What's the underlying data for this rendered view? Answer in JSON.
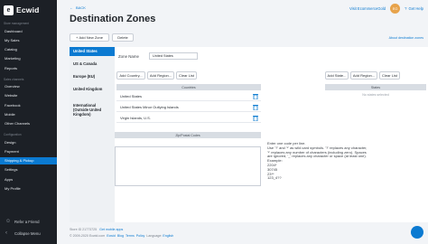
{
  "sidebar": {
    "brand": "Ecwid",
    "sections": [
      {
        "title": "Store management",
        "items": [
          "Dashboard",
          "My Sales",
          "Catalog",
          "Marketing",
          "Reports"
        ]
      },
      {
        "title": "Sales channels",
        "items": [
          "Overview",
          "Website",
          "Facebook",
          "Mobile",
          "Other Channels"
        ]
      },
      {
        "title": "Configuration",
        "items": [
          "Design",
          "Payment",
          "Shipping & Pickup",
          "Settings",
          "Apps",
          "My Profile"
        ]
      }
    ],
    "active": "Shipping & Pickup",
    "refer": "Refer a Friend",
    "collapse": "Collapse Menu"
  },
  "header": {
    "back": "BACK",
    "title": "Destination Zones",
    "webapp": "Visit EcommerceGold",
    "avatar": "EG",
    "help": "Get Help"
  },
  "toolbar": {
    "add": "Add New Zone",
    "delete": "Delete",
    "about": "About destination zones"
  },
  "zones": [
    "United States",
    "US & Canada",
    "Europe (EU)",
    "United Kingdom",
    "International (Outside United Kingdom)"
  ],
  "zone_form": {
    "name_label": "Zone Name",
    "name_value": "United States",
    "add_country": "Add Country...",
    "add_region": "Add Region...",
    "clear": "Clear List",
    "add_state": "Add State...",
    "add_region2": "Add Region...",
    "clear2": "Clear List",
    "countries_header": "Countries",
    "countries": [
      "United States",
      "United States Minor Outlying Islands",
      "Virgin Islands, U.S."
    ],
    "states_header": "States",
    "states_empty": "No states selected",
    "zip_header": "Zip/Postal Codes",
    "hint": "Enter one code per line.\nUse '?' and '*' as wild card symbols. '?' replaces any character, '*' replaces any number of characters (including zero). Spaces are ignored, '_' replaces any character or space (at least one).\nExample:\n2204*\n30745\n23**\n123_4??"
  },
  "footer": {
    "store": "Store ID 21773725",
    "upgrade": "Get mobile apps",
    "copyright": "© 2009-2020 Ecwid.com",
    "links": [
      "Ecwid",
      "Blog",
      "Terms",
      "Policy"
    ],
    "language_label": "Language:",
    "language": "English"
  }
}
